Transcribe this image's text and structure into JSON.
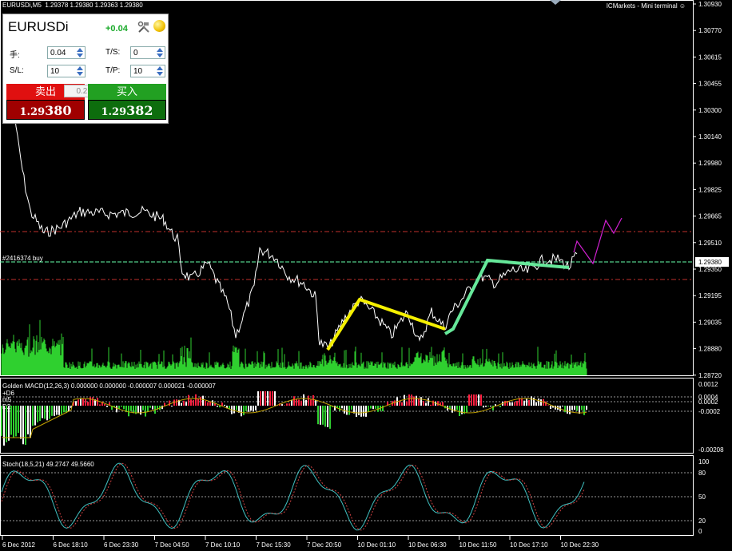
{
  "window": {
    "title_symbol": "EURUSDi,M5",
    "ohlc": "1.29378 1.29380 1.29363 1.29380",
    "broker": "ICMarkets - Mini terminal"
  },
  "panel": {
    "symbol": "EURUSDi",
    "change": "+0.04",
    "lots_label": "手:",
    "lots_value": "0.04",
    "ts_label": "T/S:",
    "ts_value": "0",
    "sl_label": "S/L:",
    "sl_value": "10",
    "tp_label": "T/P:",
    "tp_value": "10",
    "lot_step": "0.2",
    "sell_label": "卖出",
    "sell_price_small": "1.29",
    "sell_price_big": "380",
    "buy_label": "买入",
    "buy_price_small": "1.29",
    "buy_price_big": "382",
    "colors": {
      "sell": "#d00000",
      "buy": "#1a8a1a"
    }
  },
  "main_chart": {
    "price_labels": [
      "1.30930",
      "1.30770",
      "1.30615",
      "1.30455",
      "1.30300",
      "1.30140",
      "1.29980",
      "1.29825",
      "1.29665",
      "1.29510",
      "1.29350",
      "1.29195",
      "1.29035",
      "1.28880",
      "1.28720"
    ],
    "current_price": "1.29380",
    "order_label": "#2416374 buy"
  },
  "macd": {
    "title": "Golden MACD(12,26,3) 0.000000 0.000000 -0.000007 0.000021 -0.000007",
    "labels": [
      "0.0012",
      "0.0004",
      "0.0002",
      "-0.0002",
      "-0.00208"
    ],
    "side_labels": [
      "+D6",
      "m5",
      "D2"
    ]
  },
  "stoch": {
    "title": "Stoch(18,5,21) 49.2747 49.5660",
    "labels": [
      "100",
      "80",
      "50",
      "20",
      "0"
    ]
  },
  "time_axis": [
    "6 Dec 2012",
    "6 Dec 18:10",
    "6 Dec 23:30",
    "7 Dec 04:50",
    "7 Dec 10:10",
    "7 Dec 15:30",
    "7 Dec 20:50",
    "10 Dec 01:10",
    "10 Dec 06:30",
    "10 Dec 11:50",
    "10 Dec 17:10",
    "10 Dec 22:30"
  ]
}
